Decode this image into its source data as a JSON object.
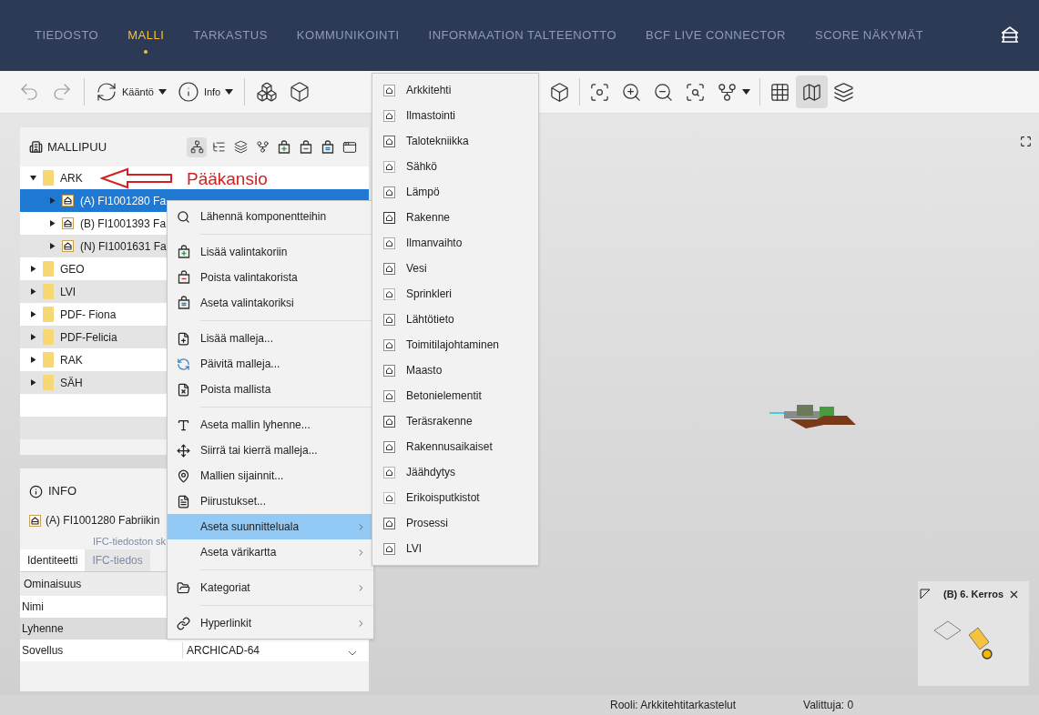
{
  "nav": {
    "tabs": [
      {
        "label": "TIEDOSTO",
        "selected": false
      },
      {
        "label": "MALLI",
        "selected": true
      },
      {
        "label": "TARKASTUS",
        "selected": false
      },
      {
        "label": "KOMMUNIKOINTI",
        "selected": false
      },
      {
        "label": "INFORMAATION TALTEENOTTO",
        "selected": false
      },
      {
        "label": "BCF LIVE CONNECTOR",
        "selected": false
      },
      {
        "label": "SCORE NÄKYMÄT",
        "selected": false
      }
    ]
  },
  "toolbar": {
    "left": [
      {
        "dropdown": false,
        "selected": false
      },
      {
        "dropdown": false,
        "selected": false
      },
      {
        "label": "Kääntö",
        "dropdown": true,
        "selected": false
      },
      {
        "label": "Info",
        "dropdown": true,
        "selected": false
      },
      {
        "dropdown": false,
        "selected": false
      },
      {
        "dropdown": false,
        "selected": false
      }
    ],
    "right": [
      {
        "dropdown": false,
        "selected": false
      },
      {
        "dropdown": false,
        "selected": false
      },
      {
        "dropdown": false,
        "selected": false
      },
      {
        "dropdown": false,
        "selected": false
      },
      {
        "dropdown": false,
        "selected": false
      },
      {
        "dropdown": true,
        "selected": false
      },
      {
        "dropdown": false,
        "selected": false
      },
      {
        "dropdown": false,
        "selected": true
      },
      {
        "dropdown": false,
        "selected": false
      }
    ]
  },
  "model_tree": {
    "title": "MALLIPUU",
    "tools": [
      {
        "selected": true
      },
      {
        "selected": false
      },
      {
        "selected": false
      },
      {
        "selected": false
      },
      {
        "selected": false
      },
      {
        "selected": false
      },
      {
        "selected": false
      },
      {
        "selected": false
      }
    ],
    "items": [
      {
        "kind": "folder",
        "label": "ARK",
        "expanded": true,
        "selected": false,
        "children": [
          {
            "kind": "model",
            "label": "(A) FI1001280 Fa",
            "expanded": false,
            "selected": true
          },
          {
            "kind": "model",
            "label": "(B) FI1001393 Fa",
            "expanded": false,
            "selected": false
          },
          {
            "kind": "model",
            "label": "(N) FI1001631 Fa",
            "expanded": false,
            "selected": false
          }
        ]
      },
      {
        "kind": "folder",
        "label": "GEO",
        "expanded": false,
        "selected": false
      },
      {
        "kind": "folder",
        "label": "LVI",
        "expanded": false,
        "selected": false
      },
      {
        "kind": "folder",
        "label": "PDF- Fiona",
        "expanded": false,
        "selected": false
      },
      {
        "kind": "folder",
        "label": "PDF-Felicia",
        "expanded": false,
        "selected": false
      },
      {
        "kind": "folder",
        "label": "RAK",
        "expanded": false,
        "selected": false
      },
      {
        "kind": "folder",
        "label": "SÄH",
        "expanded": false,
        "selected": false
      }
    ]
  },
  "annotation": {
    "label": "Pääkansio"
  },
  "info": {
    "title": "INFO",
    "model": "(A) FI1001280 Fabriikin",
    "group_tab": "IFC-tiedoston sk",
    "tabs": [
      {
        "label": "Identiteetti",
        "selected": true
      },
      {
        "label": "IFC-tiedos",
        "selected": false
      }
    ],
    "columns": [
      "Ominaisuus"
    ],
    "rows": [
      {
        "name": "Nimi"
      },
      {
        "name": "Lyhenne"
      },
      {
        "name": "Sovellus",
        "value": "ARCHICAD-64"
      }
    ]
  },
  "context_menu": {
    "groups": [
      [
        {
          "label": "Lähennä komponentteihin",
          "submenu": false,
          "selected": false
        }
      ],
      [
        {
          "label": "Lisää valintakoriin",
          "submenu": false,
          "selected": false
        },
        {
          "label": "Poista valintakorista",
          "submenu": false,
          "selected": false
        },
        {
          "label": "Aseta valintakoriksi",
          "submenu": false,
          "selected": false
        }
      ],
      [
        {
          "label": "Lisää malleja...",
          "submenu": false,
          "selected": false
        },
        {
          "label": "Päivitä malleja...",
          "submenu": false,
          "selected": false
        },
        {
          "label": "Poista mallista",
          "submenu": false,
          "selected": false
        }
      ],
      [
        {
          "label": "Aseta mallin lyhenne...",
          "submenu": false,
          "selected": false
        },
        {
          "label": "Siirrä tai kierrä malleja...",
          "submenu": false,
          "selected": false
        },
        {
          "label": "Mallien sijainnit...",
          "submenu": false,
          "selected": false
        },
        {
          "label": "Piirustukset...",
          "submenu": false,
          "selected": false
        },
        {
          "label": "Aseta suunnitteluala",
          "submenu": true,
          "selected": true
        },
        {
          "label": "Aseta värikartta",
          "submenu": true,
          "selected": false
        }
      ],
      [
        {
          "label": "Kategoriat",
          "submenu": true,
          "selected": false
        }
      ],
      [
        {
          "label": "Hyperlinkit",
          "submenu": true,
          "selected": false
        }
      ]
    ]
  },
  "discipline_menu": {
    "items": [
      {
        "label": "Arkkitehti",
        "color": "#c8a050"
      },
      {
        "label": "Ilmastointi",
        "color": "#5fc8c8"
      },
      {
        "label": "Talotekniikka",
        "color": "#4a6a8a"
      },
      {
        "label": "Sähkö",
        "color": "#e0b060"
      },
      {
        "label": "Lämpö",
        "color": "#e07070"
      },
      {
        "label": "Rakenne",
        "color": "#333333"
      },
      {
        "label": "Ilmanvaihto",
        "color": "#70c8b0"
      },
      {
        "label": "Vesi",
        "color": "#3a8ac8"
      },
      {
        "label": "Sprinkleri",
        "color": "#b0b8c8"
      },
      {
        "label": "Lähtötieto",
        "color": "#8080a0"
      },
      {
        "label": "Toimitilajohtaminen",
        "color": "#d070c0"
      },
      {
        "label": "Maasto",
        "color": "#60a040"
      },
      {
        "label": "Betonielementit",
        "color": "#a0a040"
      },
      {
        "label": "Teräsrakenne",
        "color": "#a03030"
      },
      {
        "label": "Rakennusaikaiset",
        "color": "#908060"
      },
      {
        "label": "Jäähdytys",
        "color": "#80c8e0"
      },
      {
        "label": "Erikoisputkistot",
        "color": "#d8d040"
      },
      {
        "label": "Prosessi",
        "color": "#b04080"
      },
      {
        "label": "LVI",
        "color": "#7090a0"
      }
    ]
  },
  "minimap": {
    "title": "(B) 6. Kerros"
  },
  "status_bar": {
    "role": "Rooli: Arkkitehtitarkastelut",
    "selected_count": "Valittuja: 0"
  }
}
